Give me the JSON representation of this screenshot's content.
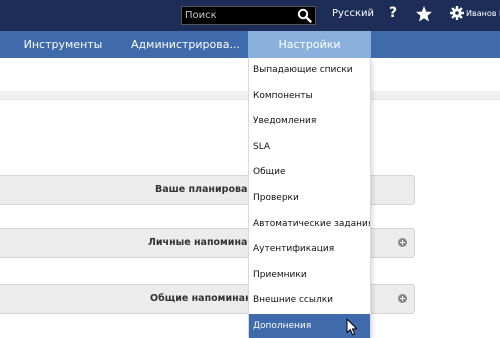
{
  "header": {
    "search": {
      "placeholder": "Поиск",
      "value": ""
    },
    "language": "Русский",
    "help_label": "?",
    "user": "Иванов І"
  },
  "nav": {
    "items": [
      {
        "label": "Инструменты"
      },
      {
        "label": "Администрирова..."
      },
      {
        "label": "Настройки"
      }
    ]
  },
  "panels": [
    {
      "title": "Ваше планирование"
    },
    {
      "title": "Личные напоминания"
    },
    {
      "title": "Общие напоминания"
    }
  ],
  "settings_menu": {
    "items": [
      {
        "label": "Выпадающие списки"
      },
      {
        "label": "Компоненты"
      },
      {
        "label": "Уведомления"
      },
      {
        "label": "SLA"
      },
      {
        "label": "Общие"
      },
      {
        "label": "Проверки"
      },
      {
        "label": "Автоматические задания"
      },
      {
        "label": "Аутентификация"
      },
      {
        "label": "Приемники"
      },
      {
        "label": "Внешние ссылки"
      },
      {
        "label": "Дополнения"
      }
    ],
    "active_item": "Дополнения"
  },
  "colors": {
    "topbar": "#1d2d57",
    "navbar": "#3f6aab",
    "nav_active": "#8ab0dd",
    "menu_highlight": "#3f6aab"
  },
  "icons": [
    "search-icon",
    "help-icon",
    "star-icon",
    "gear-icon",
    "plus-icon",
    "cursor-icon"
  ]
}
